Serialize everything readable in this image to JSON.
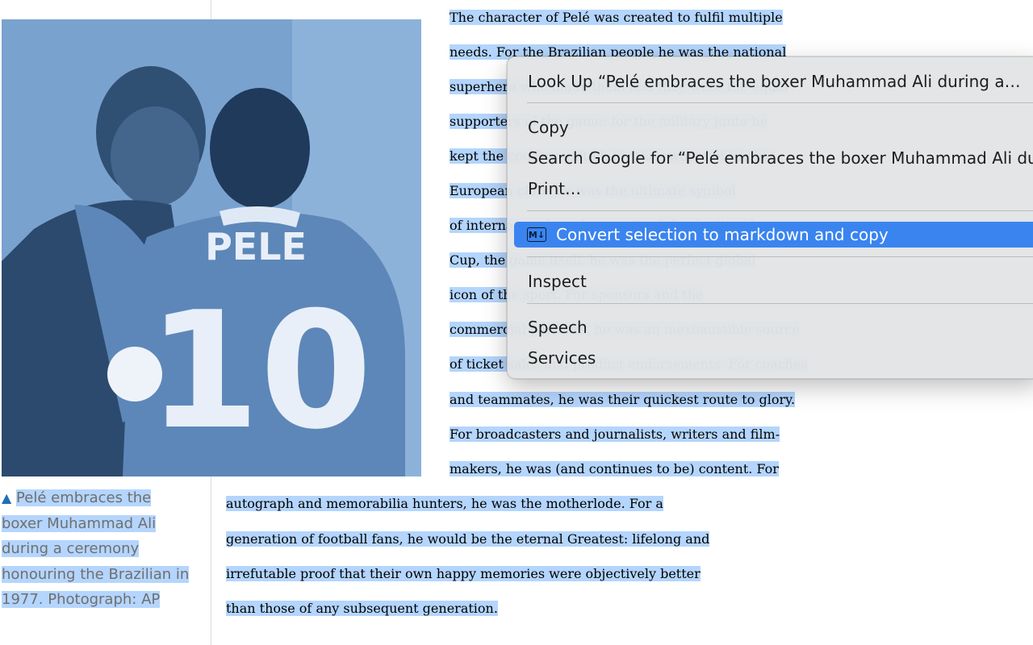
{
  "caption": {
    "marker": "▲",
    "text": "Pelé embraces the boxer Muhammad Ali during a ceremony honouring the Brazilian in 1977. Photograph: AP",
    "lines": [
      "Pelé embraces the",
      "boxer Muhammad Ali",
      "during a ceremony",
      "honouring the Brazilian in",
      "1977. Photograph: AP"
    ]
  },
  "photo": {
    "alt": "Pelé embraces the boxer Muhammad Ali",
    "shirt_name": "PELE",
    "shirt_number": "10"
  },
  "article": {
    "lines": [
      "The character of Pelé was created to fulfil multiple",
      "needs. For the Brazilian people he was the national",
      "superhero who made them feel they were the equal",
      "supporters of the game; for the military junta he",
      "kept the country united; for the owners of the big",
      "European clubs he was the ultimate symbol",
      "of international marketing. For Fifa, the World",
      "Cup, the game itself, he was the perfect global",
      "icon of the sport. For sponsors and the",
      "commercial partners, he was an inexhaustible source",
      "of ticket sales and product endorsements. For coaches",
      "and teammates, he was their quickest route to glory.",
      "For broadcasters and journalists, writers and film-",
      "makers, he was (and continues to be) content. For",
      "autograph and memorabilia hunters, he was the motherlode. For a",
      "generation of football fans, he would be the eternal Greatest: lifelong and",
      "irrefutable proof that their own happy memories were objectively better",
      "than those of any subsequent generation."
    ]
  },
  "context_menu": {
    "look_up": "Look Up “Pelé embraces the boxer Muhammad Ali during a…",
    "copy": "Copy",
    "search_google": "Search Google for “Pelé embraces the boxer Muhammad Ali during a…”",
    "print": "Print…",
    "convert_markdown": "Convert selection to markdown and copy",
    "convert_icon": "M↓",
    "inspect": "Inspect",
    "speech": "Speech",
    "services": "Services"
  },
  "colors": {
    "selection": "#b4d5fd",
    "menu_highlight": "#3a84f0",
    "photo_tint": "#6f98c6"
  }
}
